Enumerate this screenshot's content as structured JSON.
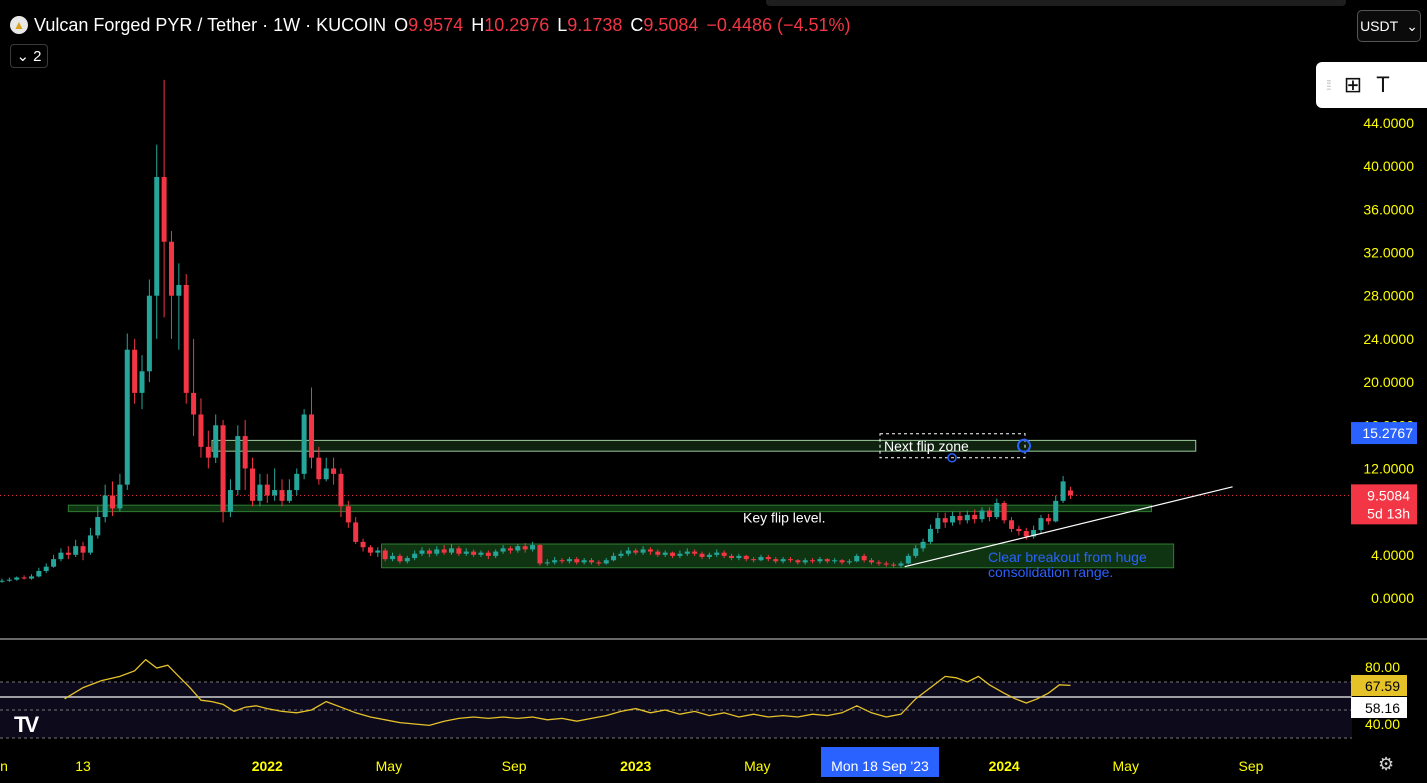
{
  "header": {
    "symbol_title": "Vulcan Forged PYR / Tether · 1W · KUCOIN",
    "open_key": "O",
    "open": "9.9574",
    "high_key": "H",
    "high": "10.2976",
    "low_key": "L",
    "low": "9.1738",
    "close_key": "C",
    "close": "9.5084",
    "change": "−0.4486 (−4.51%)",
    "collapse_count": "2",
    "currency": "USDT"
  },
  "colors": {
    "up": "#26a69a",
    "down": "#f23645",
    "axis_text": "#ffff00",
    "zone_fill": "#1b5e20",
    "price_label": "#f23645",
    "zone_label": "#2962ff",
    "rsi_line": "#e6c229"
  },
  "icons": {
    "symbol_logo": "pyr-logo-icon",
    "collapse": "chevron-down-icon",
    "currency": "chevron-down-icon",
    "drag": "drag-handle-icon",
    "objects": "object-tree-icon",
    "text": "text-tool-icon",
    "brand": "tradingview-logo-icon",
    "settings": "gear-icon"
  },
  "chart_data": {
    "type": "candlestick",
    "price_axis": {
      "ticks": [
        "44.0000",
        "40.0000",
        "36.0000",
        "32.0000",
        "28.0000",
        "24.0000",
        "20.0000",
        "16.0000",
        "12.0000",
        "8.0000",
        "4.0000",
        "0.0000"
      ],
      "tick_values": [
        44,
        40,
        36,
        32,
        28,
        24,
        20,
        16,
        12,
        8,
        4,
        0
      ],
      "ylim": [
        -1,
        50
      ]
    },
    "time_axis": {
      "labels": [
        "n",
        "13",
        "2022",
        "May",
        "Sep",
        "2023",
        "May",
        "Mon 18 Sep '23",
        "2024",
        "May",
        "Sep"
      ],
      "label_values": [
        2021.3,
        2021.5,
        2022.0,
        2022.33,
        2022.67,
        2023.0,
        2023.33,
        2023.71,
        2024.0,
        2024.33,
        2024.67
      ],
      "crosshair_label": "Mon 18 Sep '23"
    },
    "last_price": {
      "label": "9.5084",
      "value": 9.5084,
      "countdown": "5d 13h"
    },
    "zone_price": {
      "label": "15.2767",
      "value": 15.2767
    },
    "candles": [
      [
        2021.28,
        1.6,
        1.6,
        1.4,
        1.8
      ],
      [
        2021.3,
        1.6,
        1.7,
        1.5,
        1.9
      ],
      [
        2021.32,
        1.7,
        1.9,
        1.6,
        2.0
      ],
      [
        2021.34,
        1.9,
        1.8,
        1.7,
        2.1
      ],
      [
        2021.36,
        1.8,
        2.0,
        1.7,
        2.2
      ],
      [
        2021.38,
        2.0,
        2.5,
        1.9,
        2.8
      ],
      [
        2021.4,
        2.5,
        2.9,
        2.3,
        3.2
      ],
      [
        2021.42,
        2.9,
        3.6,
        2.8,
        4.0
      ],
      [
        2021.44,
        3.6,
        4.2,
        3.4,
        4.6
      ],
      [
        2021.46,
        4.2,
        4.0,
        3.6,
        4.8
      ],
      [
        2021.48,
        4.0,
        4.8,
        3.8,
        5.4
      ],
      [
        2021.5,
        4.8,
        4.2,
        3.5,
        5.2
      ],
      [
        2021.52,
        4.2,
        5.8,
        4.0,
        6.5
      ],
      [
        2021.54,
        5.8,
        7.5,
        5.5,
        8.5
      ],
      [
        2021.56,
        7.5,
        9.5,
        7.0,
        10.5
      ],
      [
        2021.58,
        9.5,
        8.3,
        7.6,
        10.8
      ],
      [
        2021.6,
        8.3,
        10.5,
        8.0,
        11.5
      ],
      [
        2021.62,
        10.5,
        23.0,
        10.0,
        24.5
      ],
      [
        2021.64,
        23.0,
        19.0,
        18.0,
        24.0
      ],
      [
        2021.66,
        19.0,
        21.0,
        17.5,
        22.5
      ],
      [
        2021.68,
        21.0,
        28.0,
        20.0,
        29.5
      ],
      [
        2021.7,
        28.0,
        39.0,
        24.0,
        42.0
      ],
      [
        2021.72,
        39.0,
        33.0,
        26.0,
        48.0
      ],
      [
        2021.74,
        33.0,
        28.0,
        24.0,
        34.0
      ],
      [
        2021.76,
        28.0,
        29.0,
        23.0,
        31.0
      ],
      [
        2021.78,
        29.0,
        19.0,
        18.0,
        30.0
      ],
      [
        2021.8,
        19.0,
        17.0,
        15.0,
        24.0
      ],
      [
        2021.82,
        17.0,
        14.0,
        13.0,
        18.5
      ],
      [
        2021.84,
        14.0,
        13.0,
        12.0,
        15.5
      ],
      [
        2021.86,
        13.0,
        16.0,
        12.5,
        17.0
      ],
      [
        2021.88,
        16.0,
        8.0,
        7.0,
        16.5
      ],
      [
        2021.9,
        8.0,
        10.0,
        7.5,
        11.0
      ],
      [
        2021.92,
        10.0,
        15.0,
        9.5,
        16.0
      ],
      [
        2021.94,
        15.0,
        12.0,
        10.0,
        16.5
      ],
      [
        2021.96,
        12.0,
        9.0,
        8.5,
        13.0
      ],
      [
        2021.98,
        9.0,
        10.5,
        8.5,
        11.5
      ],
      [
        2022.0,
        10.5,
        9.5,
        8.8,
        11.5
      ],
      [
        2022.02,
        9.5,
        10.0,
        9.0,
        12.0
      ],
      [
        2022.04,
        10.0,
        9.0,
        8.5,
        11.0
      ],
      [
        2022.06,
        9.0,
        10.0,
        8.8,
        11.0
      ],
      [
        2022.08,
        10.0,
        11.5,
        9.5,
        12.0
      ],
      [
        2022.1,
        11.5,
        17.0,
        11.0,
        17.5
      ],
      [
        2022.12,
        17.0,
        13.0,
        12.0,
        19.5
      ],
      [
        2022.14,
        13.0,
        11.0,
        10.5,
        14.0
      ],
      [
        2022.16,
        11.0,
        12.0,
        10.8,
        13.0
      ],
      [
        2022.18,
        12.0,
        11.5,
        10.5,
        13.0
      ],
      [
        2022.2,
        11.5,
        8.5,
        7.5,
        12.0
      ],
      [
        2022.22,
        8.5,
        7.0,
        6.5,
        9.0
      ],
      [
        2022.24,
        7.0,
        5.2,
        5.0,
        7.5
      ],
      [
        2022.26,
        5.2,
        4.7,
        4.3,
        5.5
      ],
      [
        2022.28,
        4.7,
        4.2,
        3.9,
        4.9
      ],
      [
        2022.3,
        4.2,
        4.4,
        3.8,
        4.7
      ],
      [
        2022.32,
        4.4,
        3.6,
        3.4,
        4.6
      ],
      [
        2022.34,
        3.6,
        3.9,
        3.4,
        4.2
      ],
      [
        2022.36,
        3.9,
        3.4,
        3.2,
        4.1
      ],
      [
        2022.38,
        3.4,
        3.7,
        3.2,
        3.9
      ],
      [
        2022.4,
        3.7,
        4.1,
        3.5,
        4.4
      ],
      [
        2022.42,
        4.1,
        4.4,
        3.9,
        4.7
      ],
      [
        2022.44,
        4.4,
        4.1,
        3.8,
        4.6
      ],
      [
        2022.46,
        4.1,
        4.5,
        3.9,
        4.8
      ],
      [
        2022.48,
        4.5,
        4.2,
        4.0,
        4.9
      ],
      [
        2022.5,
        4.2,
        4.6,
        4.0,
        5.0
      ],
      [
        2022.52,
        4.6,
        4.1,
        3.9,
        4.8
      ],
      [
        2022.54,
        4.1,
        4.3,
        3.9,
        4.6
      ],
      [
        2022.56,
        4.3,
        4.0,
        3.8,
        4.5
      ],
      [
        2022.58,
        4.0,
        4.2,
        3.8,
        4.4
      ],
      [
        2022.6,
        4.2,
        3.9,
        3.6,
        4.4
      ],
      [
        2022.62,
        3.9,
        4.3,
        3.7,
        4.5
      ],
      [
        2022.64,
        4.3,
        4.6,
        4.1,
        4.9
      ],
      [
        2022.66,
        4.6,
        4.4,
        4.1,
        4.8
      ],
      [
        2022.68,
        4.4,
        4.8,
        4.2,
        5.0
      ],
      [
        2022.7,
        4.8,
        4.5,
        4.2,
        5.1
      ],
      [
        2022.72,
        4.5,
        4.9,
        4.3,
        5.2
      ],
      [
        2022.74,
        4.9,
        3.2,
        3.0,
        5.0
      ],
      [
        2022.76,
        3.2,
        3.3,
        3.0,
        3.6
      ],
      [
        2022.78,
        3.3,
        3.5,
        3.1,
        3.8
      ],
      [
        2022.8,
        3.5,
        3.4,
        3.2,
        3.7
      ],
      [
        2022.82,
        3.4,
        3.6,
        3.2,
        3.8
      ],
      [
        2022.84,
        3.6,
        3.3,
        3.1,
        3.8
      ],
      [
        2022.86,
        3.3,
        3.5,
        3.1,
        3.7
      ],
      [
        2022.88,
        3.5,
        3.3,
        3.1,
        3.7
      ],
      [
        2022.9,
        3.3,
        3.2,
        3.0,
        3.5
      ],
      [
        2022.92,
        3.2,
        3.5,
        3.1,
        3.7
      ],
      [
        2022.94,
        3.5,
        3.9,
        3.4,
        4.2
      ],
      [
        2022.96,
        3.9,
        4.1,
        3.7,
        4.4
      ],
      [
        2022.98,
        4.1,
        4.4,
        3.9,
        4.7
      ],
      [
        2023.0,
        4.4,
        4.2,
        4.0,
        4.6
      ],
      [
        2023.02,
        4.2,
        4.5,
        4.0,
        4.8
      ],
      [
        2023.04,
        4.5,
        4.3,
        4.0,
        4.7
      ],
      [
        2023.06,
        4.3,
        4.0,
        3.8,
        4.5
      ],
      [
        2023.08,
        4.0,
        4.2,
        3.8,
        4.4
      ],
      [
        2023.1,
        4.2,
        3.9,
        3.7,
        4.3
      ],
      [
        2023.12,
        3.9,
        4.1,
        3.7,
        4.4
      ],
      [
        2023.14,
        4.1,
        4.3,
        3.9,
        4.6
      ],
      [
        2023.16,
        4.3,
        4.1,
        3.9,
        4.5
      ],
      [
        2023.18,
        4.1,
        3.8,
        3.6,
        4.3
      ],
      [
        2023.2,
        3.8,
        4.0,
        3.6,
        4.2
      ],
      [
        2023.22,
        4.0,
        4.2,
        3.8,
        4.5
      ],
      [
        2023.24,
        4.2,
        3.9,
        3.7,
        4.4
      ],
      [
        2023.26,
        3.9,
        3.7,
        3.5,
        4.1
      ],
      [
        2023.28,
        3.7,
        3.9,
        3.5,
        4.1
      ],
      [
        2023.3,
        3.9,
        3.6,
        3.4,
        4.0
      ],
      [
        2023.32,
        3.6,
        3.5,
        3.3,
        3.8
      ],
      [
        2023.34,
        3.5,
        3.8,
        3.4,
        4.0
      ],
      [
        2023.36,
        3.8,
        3.6,
        3.4,
        4.0
      ],
      [
        2023.38,
        3.6,
        3.4,
        3.2,
        3.8
      ],
      [
        2023.4,
        3.4,
        3.6,
        3.2,
        3.8
      ],
      [
        2023.42,
        3.6,
        3.5,
        3.3,
        3.8
      ],
      [
        2023.44,
        3.5,
        3.3,
        3.1,
        3.6
      ],
      [
        2023.46,
        3.3,
        3.5,
        3.1,
        3.7
      ],
      [
        2023.48,
        3.5,
        3.4,
        3.2,
        3.7
      ],
      [
        2023.5,
        3.4,
        3.6,
        3.2,
        3.8
      ],
      [
        2023.52,
        3.6,
        3.4,
        3.2,
        3.7
      ],
      [
        2023.54,
        3.4,
        3.5,
        3.2,
        3.7
      ],
      [
        2023.56,
        3.5,
        3.3,
        3.1,
        3.6
      ],
      [
        2023.58,
        3.3,
        3.4,
        3.1,
        3.6
      ],
      [
        2023.6,
        3.4,
        3.9,
        3.3,
        4.1
      ],
      [
        2023.62,
        3.9,
        3.5,
        3.3,
        4.1
      ],
      [
        2023.64,
        3.5,
        3.3,
        3.1,
        3.7
      ],
      [
        2023.66,
        3.3,
        3.2,
        3.0,
        3.5
      ],
      [
        2023.68,
        3.2,
        3.1,
        2.9,
        3.4
      ],
      [
        2023.7,
        3.1,
        3.0,
        2.8,
        3.3
      ],
      [
        2023.72,
        3.0,
        3.2,
        2.8,
        3.4
      ],
      [
        2023.74,
        3.2,
        3.9,
        3.1,
        4.1
      ],
      [
        2023.76,
        3.9,
        4.6,
        3.7,
        4.9
      ],
      [
        2023.78,
        4.6,
        5.2,
        4.3,
        5.5
      ],
      [
        2023.8,
        5.2,
        6.4,
        5.0,
        6.8
      ],
      [
        2023.82,
        6.4,
        7.4,
        6.0,
        7.9
      ],
      [
        2023.84,
        7.4,
        7.0,
        6.5,
        7.9
      ],
      [
        2023.86,
        7.0,
        7.6,
        6.7,
        8.0
      ],
      [
        2023.88,
        7.6,
        7.2,
        6.8,
        8.0
      ],
      [
        2023.9,
        7.2,
        7.7,
        6.9,
        8.1
      ],
      [
        2023.92,
        7.7,
        7.3,
        6.9,
        8.2
      ],
      [
        2023.94,
        7.3,
        8.1,
        7.0,
        8.4
      ],
      [
        2023.96,
        8.1,
        7.5,
        7.1,
        8.4
      ],
      [
        2023.98,
        7.5,
        8.8,
        7.3,
        9.2
      ],
      [
        2024.0,
        8.8,
        7.2,
        6.9,
        9.0
      ],
      [
        2024.02,
        7.2,
        6.4,
        6.1,
        7.5
      ],
      [
        2024.04,
        6.4,
        6.2,
        5.8,
        6.7
      ],
      [
        2024.06,
        6.2,
        5.7,
        5.4,
        6.5
      ],
      [
        2024.08,
        5.7,
        6.3,
        5.5,
        6.7
      ],
      [
        2024.1,
        6.3,
        7.4,
        6.0,
        7.7
      ],
      [
        2024.12,
        7.4,
        7.1,
        6.8,
        7.8
      ],
      [
        2024.14,
        7.1,
        9.0,
        7.0,
        9.5
      ],
      [
        2024.16,
        9.0,
        10.8,
        8.8,
        11.3
      ],
      [
        2024.18,
        9.96,
        9.51,
        9.17,
        10.3
      ]
    ],
    "rsi": {
      "ticks": [
        "80.00",
        "40.00"
      ],
      "tick_values": [
        80,
        40
      ],
      "current": "67.59",
      "current_value": 67.59,
      "signal": "58.16",
      "signal_value": 58.16,
      "ylim": [
        30,
        95
      ],
      "bands": [
        70,
        50
      ],
      "points": [
        [
          2021.45,
          58
        ],
        [
          2021.5,
          66
        ],
        [
          2021.55,
          71
        ],
        [
          2021.6,
          74
        ],
        [
          2021.64,
          78
        ],
        [
          2021.67,
          86
        ],
        [
          2021.7,
          80
        ],
        [
          2021.73,
          82
        ],
        [
          2021.76,
          74
        ],
        [
          2021.79,
          66
        ],
        [
          2021.82,
          57
        ],
        [
          2021.85,
          56
        ],
        [
          2021.88,
          54
        ],
        [
          2021.91,
          49
        ],
        [
          2021.94,
          52
        ],
        [
          2021.97,
          53
        ],
        [
          2022.0,
          51
        ],
        [
          2022.04,
          49
        ],
        [
          2022.08,
          48
        ],
        [
          2022.12,
          50
        ],
        [
          2022.16,
          56
        ],
        [
          2022.2,
          52
        ],
        [
          2022.24,
          48
        ],
        [
          2022.28,
          45
        ],
        [
          2022.32,
          43
        ],
        [
          2022.36,
          41
        ],
        [
          2022.4,
          40
        ],
        [
          2022.44,
          39
        ],
        [
          2022.48,
          42
        ],
        [
          2022.52,
          44
        ],
        [
          2022.56,
          45
        ],
        [
          2022.6,
          44
        ],
        [
          2022.64,
          45
        ],
        [
          2022.68,
          44
        ],
        [
          2022.72,
          45
        ],
        [
          2022.76,
          43
        ],
        [
          2022.8,
          44
        ],
        [
          2022.84,
          42
        ],
        [
          2022.88,
          44
        ],
        [
          2022.92,
          46
        ],
        [
          2022.96,
          49
        ],
        [
          2023.0,
          51
        ],
        [
          2023.04,
          48
        ],
        [
          2023.08,
          50
        ],
        [
          2023.12,
          47
        ],
        [
          2023.16,
          49
        ],
        [
          2023.2,
          46
        ],
        [
          2023.24,
          48
        ],
        [
          2023.28,
          45
        ],
        [
          2023.32,
          47
        ],
        [
          2023.36,
          45
        ],
        [
          2023.4,
          46
        ],
        [
          2023.44,
          45
        ],
        [
          2023.48,
          47
        ],
        [
          2023.52,
          46
        ],
        [
          2023.56,
          48
        ],
        [
          2023.6,
          53
        ],
        [
          2023.64,
          48
        ],
        [
          2023.68,
          45
        ],
        [
          2023.72,
          47
        ],
        [
          2023.76,
          58
        ],
        [
          2023.8,
          66
        ],
        [
          2023.84,
          74
        ],
        [
          2023.87,
          73
        ],
        [
          2023.9,
          70
        ],
        [
          2023.93,
          74
        ],
        [
          2023.96,
          68
        ],
        [
          2024.0,
          62
        ],
        [
          2024.03,
          58
        ],
        [
          2024.06,
          55
        ],
        [
          2024.09,
          58
        ],
        [
          2024.12,
          62
        ],
        [
          2024.15,
          68
        ],
        [
          2024.18,
          67.59
        ]
      ]
    },
    "annotations": {
      "next_flip_label": "Next flip zone",
      "key_flip_label": "Key flip level.",
      "breakout_label_1": "Clear breakout from huge",
      "breakout_label_2": "consolidation range.",
      "next_flip_zone": [
        2021.85,
        2024.52,
        13.6,
        14.6
      ],
      "key_flip_level": [
        2021.46,
        2024.4,
        8.0,
        8.6
      ],
      "consolidation_range": [
        2022.31,
        2024.46,
        2.8,
        5.0
      ],
      "trendline": [
        2023.73,
        2.9,
        2024.62,
        10.3
      ]
    }
  }
}
